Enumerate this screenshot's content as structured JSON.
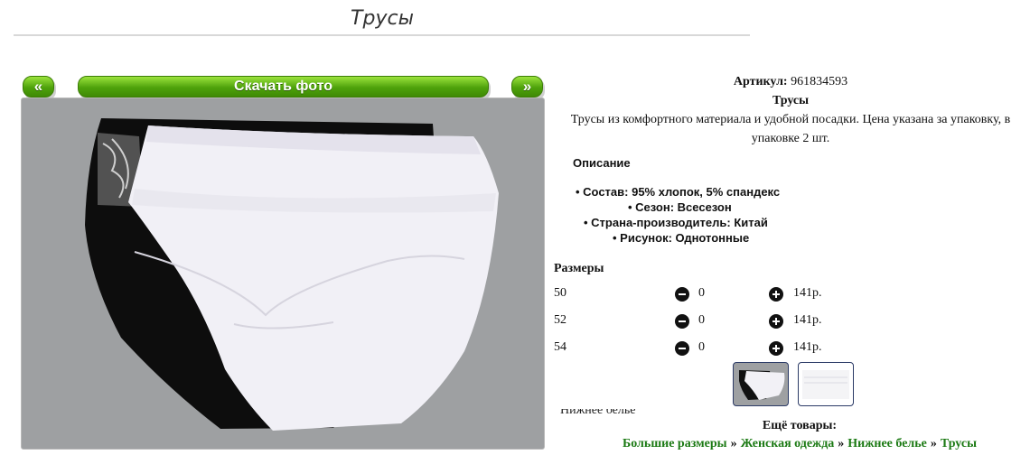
{
  "page": {
    "title": "Трусы"
  },
  "gallery": {
    "prev_label": "«",
    "download_label": "Скачать фото",
    "next_label": "»"
  },
  "product": {
    "article_label": "Артикул:",
    "article_value": "961834593",
    "name": "Трусы",
    "description": "Трусы из комфортного материала и удобной посадки. Цена указана за упаковку, в упаковке 2 шт.",
    "specs_heading": "Описание",
    "specs": [
      "Состав: 95% хлопок, 5% спандекс",
      "Сезон: Всесезон",
      "Страна-производитель: Китай",
      "Рисунок: Однотонные"
    ]
  },
  "sizes": {
    "heading": "Размеры",
    "rows": [
      {
        "size": "50",
        "qty": "0",
        "price": "141р."
      },
      {
        "size": "52",
        "qty": "0",
        "price": "141р."
      },
      {
        "size": "54",
        "qty": "0",
        "price": "141р."
      }
    ]
  },
  "partial_text": "Нижнее белье",
  "more": {
    "heading": "Ещё товары:",
    "crumbs": [
      "Большие размеры",
      "Женская одежда",
      "Нижнее белье",
      "Трусы"
    ],
    "separator": "»"
  },
  "colors": {
    "accent_green": "#4ea20b",
    "link_green": "#1c7a14",
    "photo_bg": "#9ea0a2"
  }
}
